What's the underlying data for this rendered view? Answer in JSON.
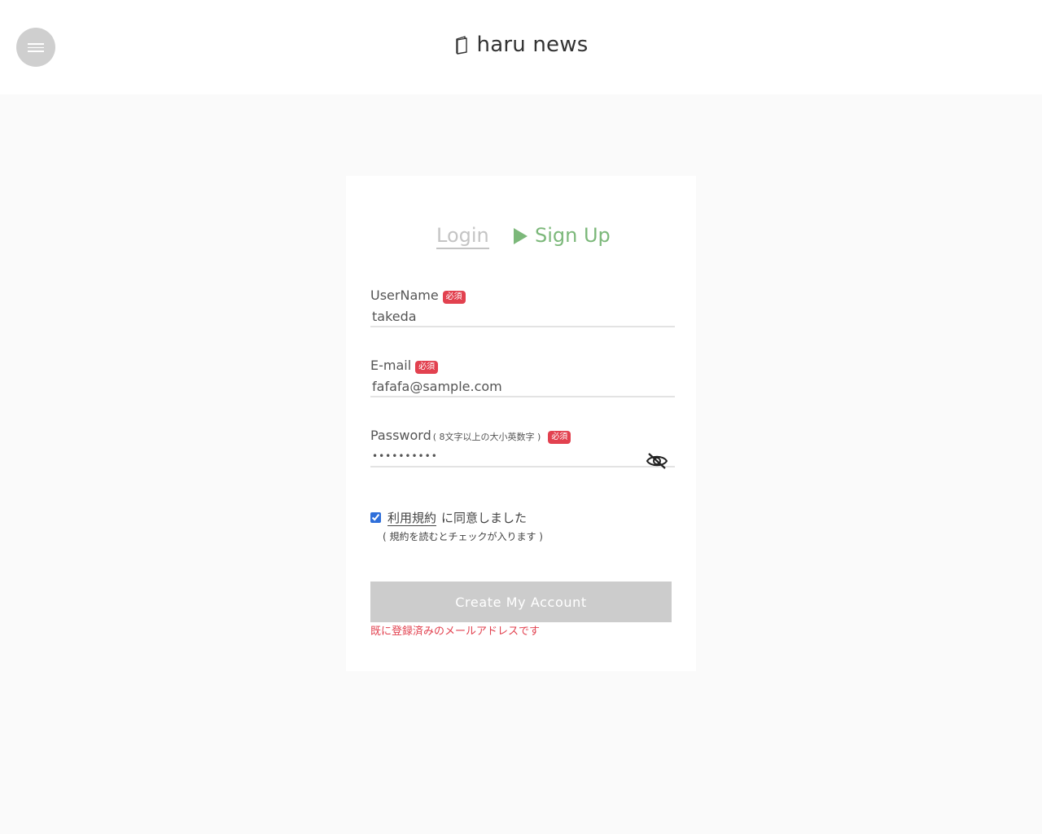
{
  "header": {
    "brand": "haru news"
  },
  "tabs": {
    "login": "Login",
    "signup": "Sign Up",
    "active": "signup"
  },
  "form": {
    "required_badge": "必須",
    "username": {
      "label": "UserName",
      "value": "takeda"
    },
    "email": {
      "label": "E-mail",
      "value": "fafafa@sample.com"
    },
    "password": {
      "label": "Password",
      "note": "( 8文字以上の大小英数字 )",
      "value": "••••••••••"
    },
    "terms": {
      "checked": true,
      "link": "利用規約",
      "text": "に同意しました",
      "hint": "( 規約を読むとチェックが入ります )"
    },
    "submit_label": "Create My Account",
    "error": "既に登録済みのメールアドレスです"
  },
  "colors": {
    "accent_green": "#7cb87a",
    "required_red": "#e2414f",
    "button_disabled": "#cccccc"
  }
}
